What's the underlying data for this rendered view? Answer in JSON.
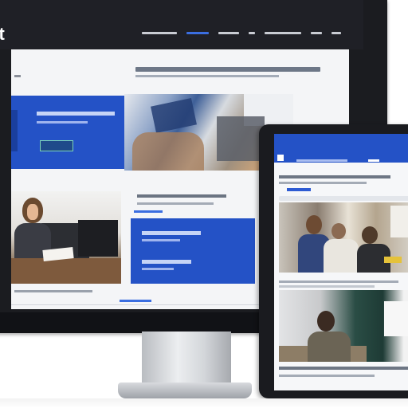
{
  "desktop": {
    "brand_logo": "ut",
    "nav_items": [
      {
        "w": 44,
        "active": false
      },
      {
        "w": 28,
        "active": true
      },
      {
        "w": 26,
        "active": false
      },
      {
        "w": 8,
        "active": false
      },
      {
        "w": 46,
        "active": false
      },
      {
        "w": 14,
        "active": false
      },
      {
        "w": 12,
        "active": false
      }
    ]
  },
  "tablet": {},
  "colors": {
    "accent_blue": "#2452c6",
    "frame_dark": "#1b1c20",
    "page_bg": "#f4f5f7"
  },
  "icons": [
    "brand-logo-icon",
    "camera-icon"
  ]
}
